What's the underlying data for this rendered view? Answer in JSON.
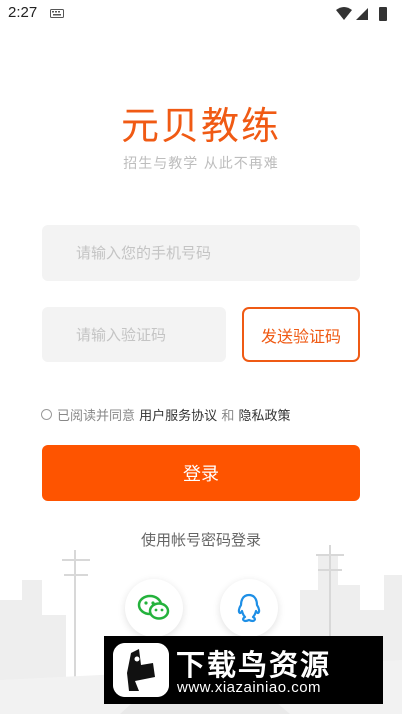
{
  "status_bar": {
    "time": "2:27"
  },
  "app": {
    "title": "元贝教练",
    "slogan": "招生与教学  从此不再难"
  },
  "form": {
    "phone_placeholder": "请输入您的手机号码",
    "code_placeholder": "请输入验证码",
    "send_code_label": "发送验证码",
    "agreement_prefix": "已阅读并同意",
    "agreement_link1": "用户服务协议",
    "agreement_and": "和",
    "agreement_link2": "隐私政策",
    "login_label": "登录",
    "alt_login_label": "使用帐号密码登录"
  },
  "social": {
    "items": [
      "wechat-icon",
      "qq-icon"
    ]
  },
  "watermark": {
    "title": "下载鸟资源",
    "url": "www.xiazainiao.com"
  },
  "colors": {
    "accent": "#fe5400",
    "brand_text": "#f05a14"
  }
}
